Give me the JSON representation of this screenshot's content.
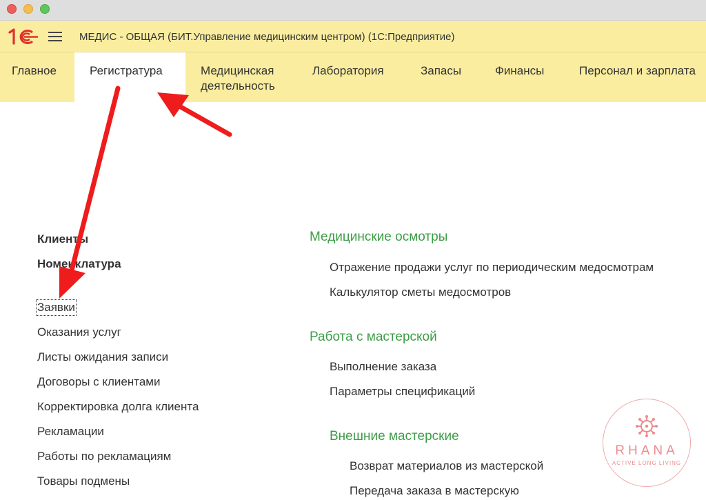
{
  "window": {
    "title": "МЕДИС - ОБЩАЯ (БИТ.Управление медицинским центром)  (1С:Предприятие)"
  },
  "nav": {
    "items": [
      {
        "label": "Главное"
      },
      {
        "label": "Регистратура",
        "active": true
      },
      {
        "label": "Медицинская деятельность"
      },
      {
        "label": "Лаборатория"
      },
      {
        "label": "Запасы"
      },
      {
        "label": "Финансы"
      },
      {
        "label": "Персонал и зарплата"
      }
    ]
  },
  "left_panel": {
    "bold_links": [
      "Клиенты",
      "Номенклатура"
    ],
    "links": [
      "Заявки",
      "Оказания услуг",
      "Листы ожидания записи",
      "Договоры с клиентами",
      "Корректировка долга клиента",
      "Рекламации",
      "Работы по рекламациям",
      "Товары подмены"
    ],
    "focused_link": "Заявки"
  },
  "right_panel": {
    "groups": [
      {
        "title": "Медицинские осмотры",
        "links": [
          "Отражение продажи услуг по периодическим медосмотрам",
          "Калькулятор сметы медосмотров"
        ]
      },
      {
        "title": "Работа с мастерской",
        "links": [
          "Выполнение заказа",
          "Параметры спецификаций"
        ]
      },
      {
        "title": "Внешние мастерские",
        "links": [
          "Возврат материалов из мастерской",
          "Передача заказа в мастерскую"
        ]
      }
    ]
  },
  "watermark": {
    "brand": "RHANA",
    "tagline": "ACTIVE LONG LIVING"
  },
  "icons": {
    "logo": "1c-logo-icon",
    "menu": "hamburger-menu-icon",
    "watermark": "virus-logo-icon"
  },
  "colors": {
    "header_bg": "#faeda0",
    "group_title": "#3d9d46",
    "logo_red": "#e0312b",
    "arrow_red": "#ee1c1c",
    "watermark": "#ed8b8d"
  }
}
